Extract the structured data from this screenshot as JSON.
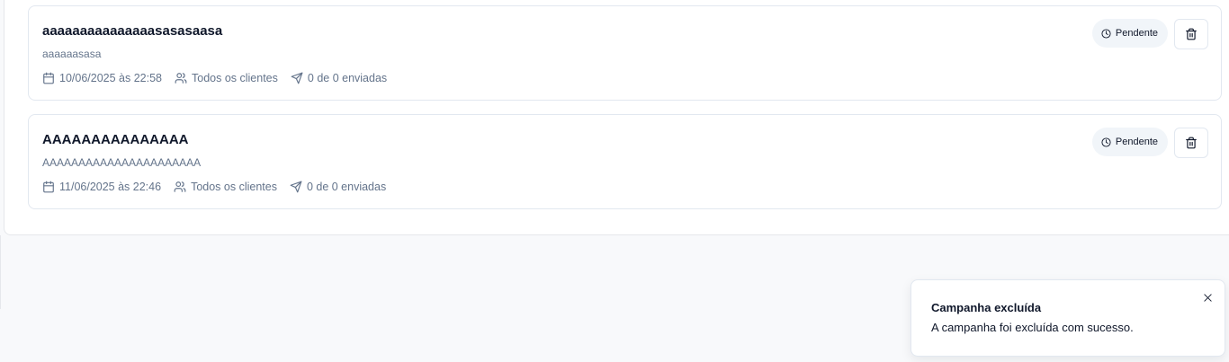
{
  "campaigns": [
    {
      "title": "aaaaaaaaaaaaaaasasasaasa",
      "description": "aaaaaasasa",
      "scheduled": "10/06/2025 às 22:58",
      "audience": "Todos os clientes",
      "sent": "0 de 0 enviadas",
      "status": "Pendente"
    },
    {
      "title": "AAAAAAAAAAAAAAA",
      "description": "AAAAAAAAAAAAAAAAAAAAAA",
      "scheduled": "11/06/2025 às 22:46",
      "audience": "Todos os clientes",
      "sent": "0 de 0 enviadas",
      "status": "Pendente"
    }
  ],
  "toast": {
    "title": "Campanha excluída",
    "message": "A campanha foi excluída com sucesso."
  },
  "icons": {
    "calendar": "calendar-icon",
    "users": "users-icon",
    "send": "send-icon",
    "clock": "clock-icon",
    "trash": "trash-icon",
    "close": "close-icon"
  },
  "colors": {
    "text_primary": "#0f172a",
    "text_muted": "#64748b",
    "badge_bg": "#f1f5f9",
    "border": "#e2e8f0",
    "page_bg": "#f8f9fb"
  }
}
